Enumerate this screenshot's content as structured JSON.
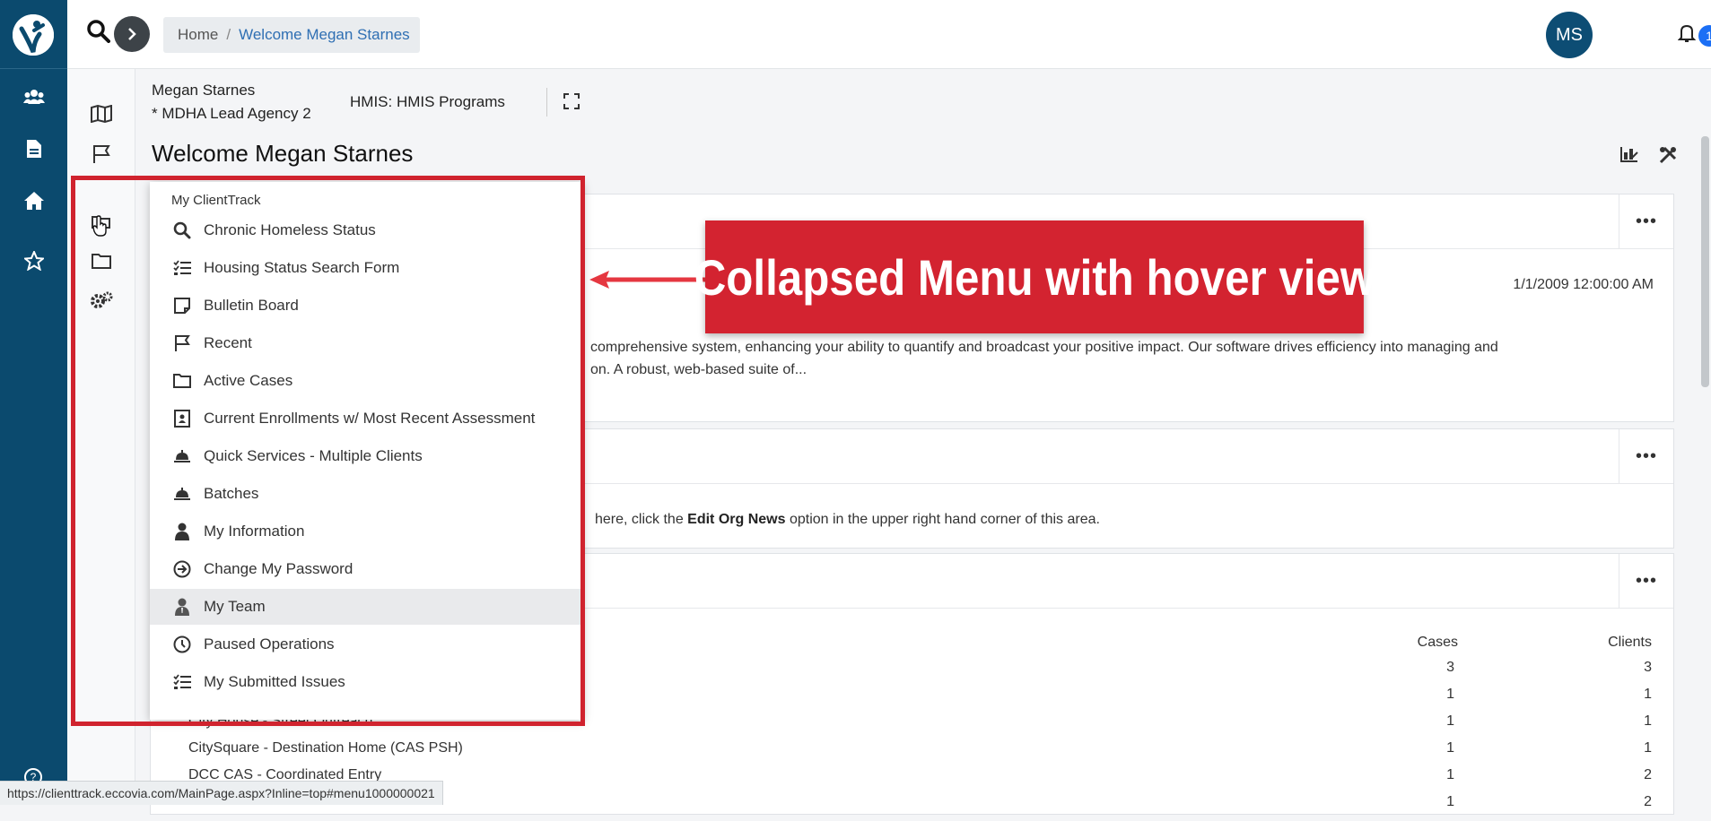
{
  "header": {
    "breadcrumb": [
      "Home",
      "Welcome Megan Starnes"
    ],
    "breadcrumb_sep": "/",
    "avatar_initials": "MS",
    "notification_count": "1"
  },
  "context": {
    "user_name": "Megan Starnes",
    "agency": "* MDHA Lead Agency 2",
    "program": "HMIS: HMIS Programs"
  },
  "page_title": "Welcome Megan Starnes",
  "rail_icons": [
    "users-icon",
    "document-icon",
    "home-icon",
    "star-icon",
    "help-icon"
  ],
  "nav_icons": [
    "map-icon",
    "flag-icon",
    "folders-icon",
    "folder-icon",
    "gears-icon"
  ],
  "panel1": {
    "date": "1/1/2009 12:00:00 AM",
    "text_line1": "comprehensive system, enhancing your ability to quantify and broadcast your positive impact.   Our software drives efficiency into managing and",
    "text_line2": "on.  A robust, web-based suite of..."
  },
  "panel2": {
    "text_before": "here, click the ",
    "text_bold": "Edit Org News",
    "text_after": " option in the upper right hand corner of this area."
  },
  "panel3": {
    "col_cases": "Cases",
    "col_clients": "Clients",
    "rows": [
      {
        "name": "",
        "cases": "3",
        "clients": "3"
      },
      {
        "name": "",
        "cases": "1",
        "clients": "1"
      },
      {
        "name": "City House - Street Outreach",
        "cases": "1",
        "clients": "1"
      },
      {
        "name": "CitySquare - Destination Home (CAS PSH)",
        "cases": "1",
        "clients": "1"
      },
      {
        "name": "DCC CAS - Coordinated Entry",
        "cases": "1",
        "clients": "2"
      },
      {
        "name": "",
        "cases": "1",
        "clients": "2"
      }
    ]
  },
  "menu": {
    "title": "My ClientTrack",
    "items": [
      {
        "label": "Chronic Homeless Status",
        "icon": "search-icon"
      },
      {
        "label": "Housing Status Search Form",
        "icon": "checklist-icon"
      },
      {
        "label": "Bulletin Board",
        "icon": "note-icon"
      },
      {
        "label": "Recent",
        "icon": "flag-icon"
      },
      {
        "label": "Active Cases",
        "icon": "folder-icon"
      },
      {
        "label": "Current Enrollments w/ Most Recent Assessment",
        "icon": "contact-card-icon"
      },
      {
        "label": "Quick Services - Multiple Clients",
        "icon": "service-bell-icon"
      },
      {
        "label": "Batches",
        "icon": "service-bell-icon"
      },
      {
        "label": "My Information",
        "icon": "person-icon"
      },
      {
        "label": "Change My Password",
        "icon": "arrow-circle-icon"
      },
      {
        "label": "My Team",
        "icon": "team-member-icon"
      },
      {
        "label": "Paused Operations",
        "icon": "clock-icon"
      },
      {
        "label": "My Submitted Issues",
        "icon": "checklist-icon"
      }
    ],
    "active_index": 10
  },
  "annotation": {
    "callout_text": "Collapsed Menu with hover view"
  },
  "status_url": "https://clienttrack.eccovia.com/MainPage.aspx?Inline=top#menu1000000021",
  "colors": {
    "rail": "#0b4a6e",
    "accent_red": "#d32330",
    "link_blue": "#2f6fb3"
  }
}
